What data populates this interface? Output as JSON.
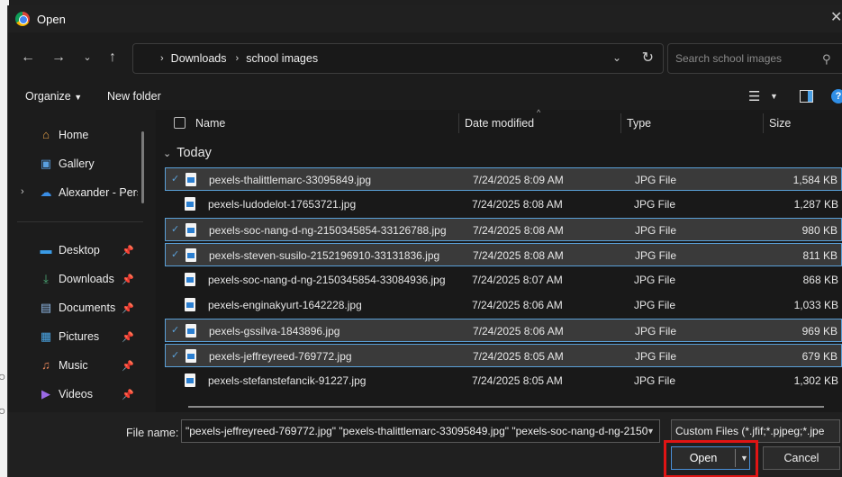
{
  "window": {
    "title": "Open"
  },
  "nav": {
    "breadcrumb": [
      "Downloads",
      "school images"
    ],
    "search_placeholder": "Search school images"
  },
  "toolbar": {
    "organize_label": "Organize",
    "new_folder_label": "New folder"
  },
  "sidebar": {
    "items": [
      {
        "label": "Home",
        "icon": "home-icon"
      },
      {
        "label": "Gallery",
        "icon": "gallery-icon"
      },
      {
        "label": "Alexander - Pers",
        "icon": "onedrive-icon"
      },
      {
        "label": "Desktop",
        "icon": "desktop-icon"
      },
      {
        "label": "Downloads",
        "icon": "downloads-icon"
      },
      {
        "label": "Documents",
        "icon": "documents-icon"
      },
      {
        "label": "Pictures",
        "icon": "pictures-icon"
      },
      {
        "label": "Music",
        "icon": "music-icon"
      },
      {
        "label": "Videos",
        "icon": "videos-icon"
      }
    ]
  },
  "columns": {
    "name": "Name",
    "date": "Date modified",
    "type": "Type",
    "size": "Size"
  },
  "group_label": "Today",
  "files": [
    {
      "name": "pexels-thalittlemarc-33095849.jpg",
      "date": "7/24/2025 8:09 AM",
      "type": "JPG File",
      "size": "1,584 KB",
      "selected": true
    },
    {
      "name": "pexels-ludodelot-17653721.jpg",
      "date": "7/24/2025 8:08 AM",
      "type": "JPG File",
      "size": "1,287 KB",
      "selected": false
    },
    {
      "name": "pexels-soc-nang-d-ng-2150345854-33126788.jpg",
      "date": "7/24/2025 8:08 AM",
      "type": "JPG File",
      "size": "980 KB",
      "selected": true
    },
    {
      "name": "pexels-steven-susilo-2152196910-33131836.jpg",
      "date": "7/24/2025 8:08 AM",
      "type": "JPG File",
      "size": "811 KB",
      "selected": true
    },
    {
      "name": "pexels-soc-nang-d-ng-2150345854-33084936.jpg",
      "date": "7/24/2025 8:07 AM",
      "type": "JPG File",
      "size": "868 KB",
      "selected": false
    },
    {
      "name": "pexels-enginakyurt-1642228.jpg",
      "date": "7/24/2025 8:06 AM",
      "type": "JPG File",
      "size": "1,033 KB",
      "selected": false
    },
    {
      "name": "pexels-gssilva-1843896.jpg",
      "date": "7/24/2025 8:06 AM",
      "type": "JPG File",
      "size": "969 KB",
      "selected": true
    },
    {
      "name": "pexels-jeffreyreed-769772.jpg",
      "date": "7/24/2025 8:05 AM",
      "type": "JPG File",
      "size": "679 KB",
      "selected": true
    },
    {
      "name": "pexels-stefanstefancik-91227.jpg",
      "date": "7/24/2025 8:05 AM",
      "type": "JPG File",
      "size": "1,302 KB",
      "selected": false
    }
  ],
  "bottom": {
    "file_name_label": "File name:",
    "file_name_value": "\"pexels-jeffreyreed-769772.jpg\" \"pexels-thalittlemarc-33095849.jpg\" \"pexels-soc-nang-d-ng-2150",
    "filter_value": "Custom Files (*.jfif;*.pjpeg;*.jpe",
    "open_label": "Open",
    "cancel_label": "Cancel"
  },
  "colors": {
    "accent": "#4a90d9",
    "highlight": "#e01414",
    "selected_row": "#3a3a3a"
  }
}
